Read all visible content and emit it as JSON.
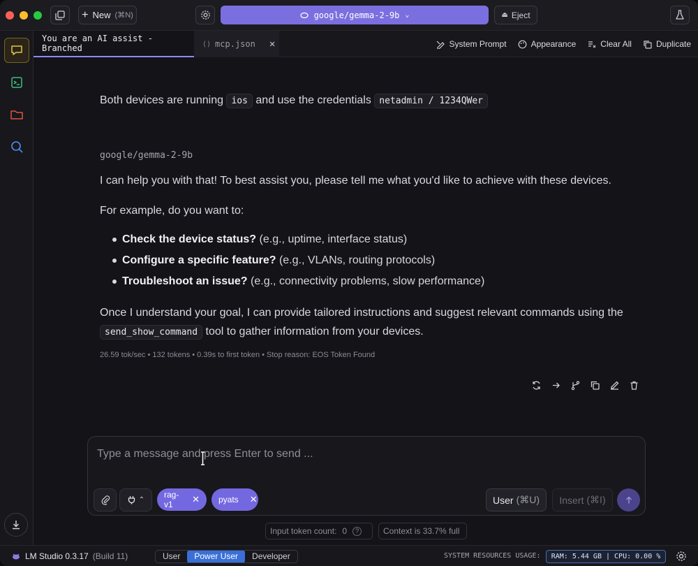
{
  "titlebar": {
    "new_label": "New",
    "new_shortcut": "(⌘N)",
    "model": "google/gemma-2-9b",
    "eject_label": "Eject"
  },
  "tabs": [
    {
      "label": "You are an AI assist - Branched"
    },
    {
      "label": "mcp.json"
    }
  ],
  "tab_actions": {
    "system_prompt": "System Prompt",
    "appearance": "Appearance",
    "clear_all": "Clear All",
    "duplicate": "Duplicate"
  },
  "chat": {
    "user_msg": {
      "part1": "Both devices are running",
      "code1": "ios",
      "part2": "and use the credentials",
      "code2": "netadmin / 1234QWer"
    },
    "assistant_name": "google/gemma-2-9b",
    "intro": "I can help you with that! To best assist you, please tell me what you'd like to achieve with these devices.",
    "example": "For example, do you want to:",
    "bullets": [
      {
        "bold": "Check the device status?",
        "rest": "(e.g., uptime, interface status)"
      },
      {
        "bold": "Configure a specific feature?",
        "rest": "(e.g., VLANs, routing protocols)"
      },
      {
        "bold": "Troubleshoot an issue?",
        "rest": "(e.g., connectivity problems, slow performance)"
      }
    ],
    "closing_part1": "Once I understand your goal, I can provide tailored instructions and suggest relevant commands using the",
    "closing_code": "send_show_command",
    "closing_part2": "tool to gather information from your devices.",
    "stats": "26.59 tok/sec • 132 tokens • 0.39s to first token • Stop reason: EOS Token Found"
  },
  "input": {
    "placeholder": "Type a message and press Enter to send ...",
    "chips": [
      "rag-v1",
      "pyats"
    ],
    "user_label": "User",
    "user_shortcut": "(⌘U)",
    "insert_label": "Insert",
    "insert_shortcut": "(⌘I)"
  },
  "meta": {
    "token_label": "Input token count:",
    "token_value": "0",
    "context": "Context is 33.7% full"
  },
  "statusbar": {
    "app": "LM Studio 0.3.17",
    "build": "(Build 11)",
    "modes": [
      "User",
      "Power User",
      "Developer"
    ],
    "active_mode": "Power User",
    "sys_label": "SYSTEM RESOURCES USAGE:",
    "resources": "RAM: 5.44 GB | CPU: 0.00 %"
  },
  "colors": {
    "accent": "#7b6fe0",
    "chip": "#7368e0",
    "background": "#131318"
  }
}
